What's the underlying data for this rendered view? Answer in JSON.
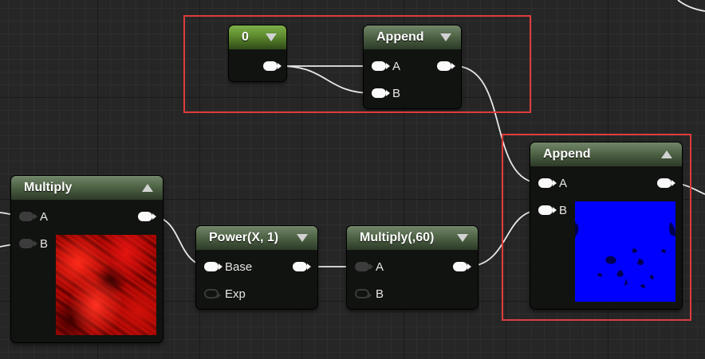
{
  "nodes": {
    "constant": {
      "title": "0"
    },
    "append_top": {
      "title": "Append",
      "pins": {
        "a": "A",
        "b": "B"
      }
    },
    "append_right": {
      "title": "Append",
      "pins": {
        "a": "A",
        "b": "B"
      }
    },
    "multiply_left": {
      "title": "Multiply",
      "pins": {
        "a": "A",
        "b": "B"
      }
    },
    "power": {
      "title": "Power(X, 1)",
      "pins": {
        "base": "Base",
        "exp": "Exp"
      }
    },
    "multiply_60": {
      "title": "Multiply(,60)",
      "pins": {
        "a": "A",
        "b": "B"
      }
    }
  },
  "colors": {
    "canvas": "#262626",
    "node_body": "#111310",
    "header_green": "#506446",
    "constant_header": "#5d8a2e",
    "selection": "#e03c3c",
    "wire": "#e8e8e8",
    "pin": "#fafafa",
    "preview_blue": "#0000ff",
    "preview_red": "#c81208"
  },
  "icons": {
    "collapse": "triangle-down-icon",
    "expand": "triangle-up-icon",
    "pin": "exec-pin-icon"
  }
}
